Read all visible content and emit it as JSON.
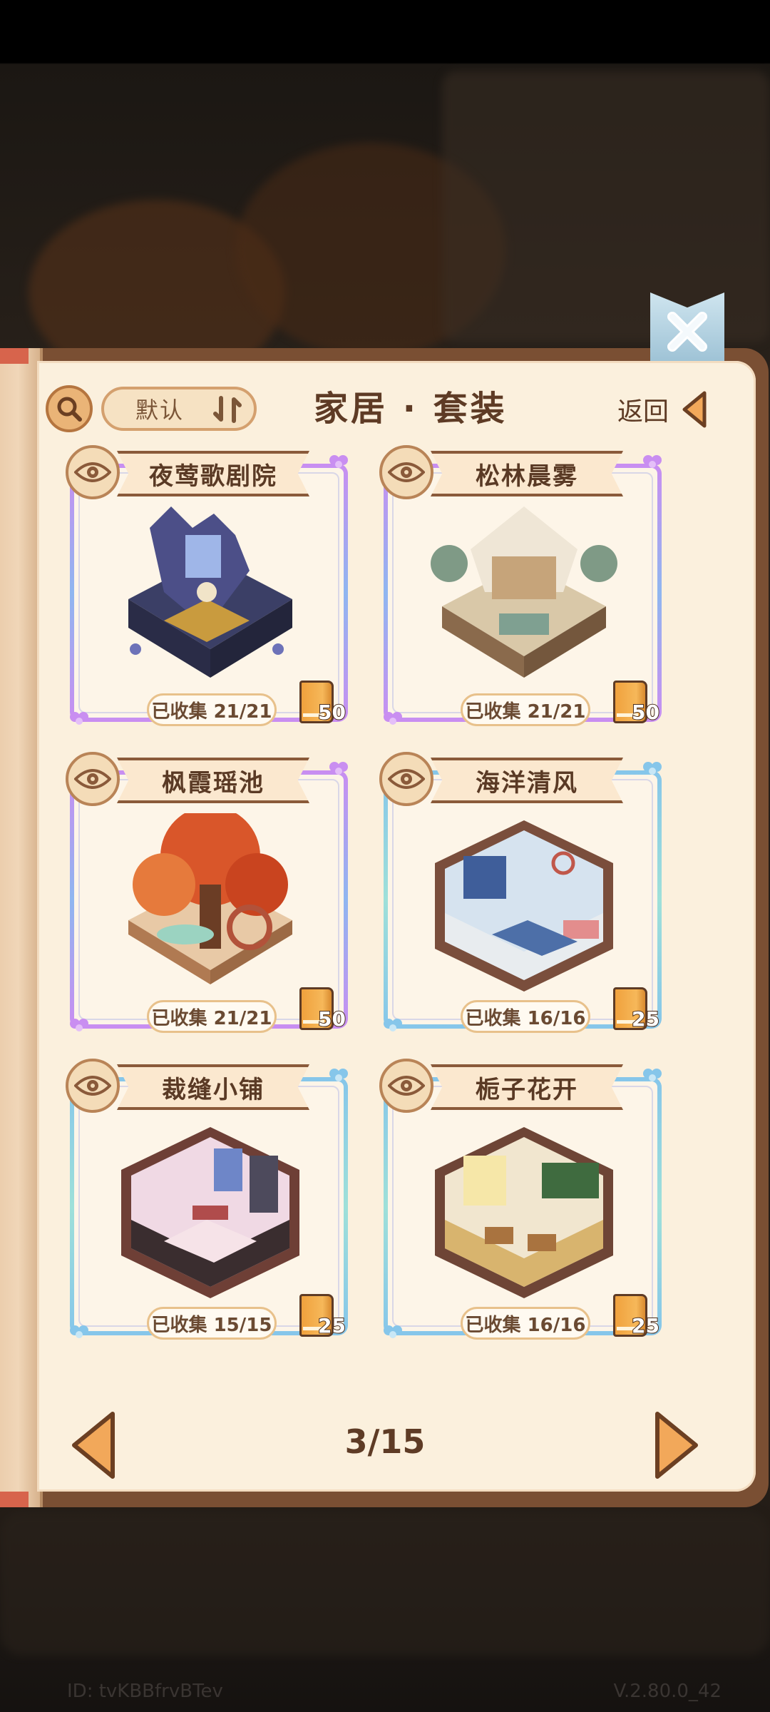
{
  "header": {
    "sort_label": "默认",
    "title": "家居 · 套装",
    "back_label": "返回"
  },
  "sets": [
    {
      "name": "夜莺歌剧院",
      "collected": "已收集 21/21",
      "reward": "50",
      "frame": "purple"
    },
    {
      "name": "松林晨雾",
      "collected": "已收集 21/21",
      "reward": "50",
      "frame": "purple"
    },
    {
      "name": "枫霞瑶池",
      "collected": "已收集 21/21",
      "reward": "50",
      "frame": "purple"
    },
    {
      "name": "海洋清风",
      "collected": "已收集 16/16",
      "reward": "25",
      "frame": "blue"
    },
    {
      "name": "裁缝小铺",
      "collected": "已收集 15/15",
      "reward": "25",
      "frame": "blue"
    },
    {
      "name": "栀子花开",
      "collected": "已收集 16/16",
      "reward": "25",
      "frame": "blue"
    }
  ],
  "pager": {
    "current": "3/15"
  },
  "footer": {
    "id": "ID: tvKBBfrvBTev",
    "version": "V.2.80.0_42"
  },
  "icons": [
    "search-icon",
    "sort-icon",
    "back-arrow-icon",
    "close-icon",
    "eye-icon",
    "book-icon",
    "prev-arrow-icon",
    "next-arrow-icon"
  ],
  "colors": {
    "page": "#fbf0dd",
    "text": "#5e3b25",
    "accent": "#eab477",
    "rare_frame": "#c98ef1",
    "common_frame": "#86c6ea"
  }
}
